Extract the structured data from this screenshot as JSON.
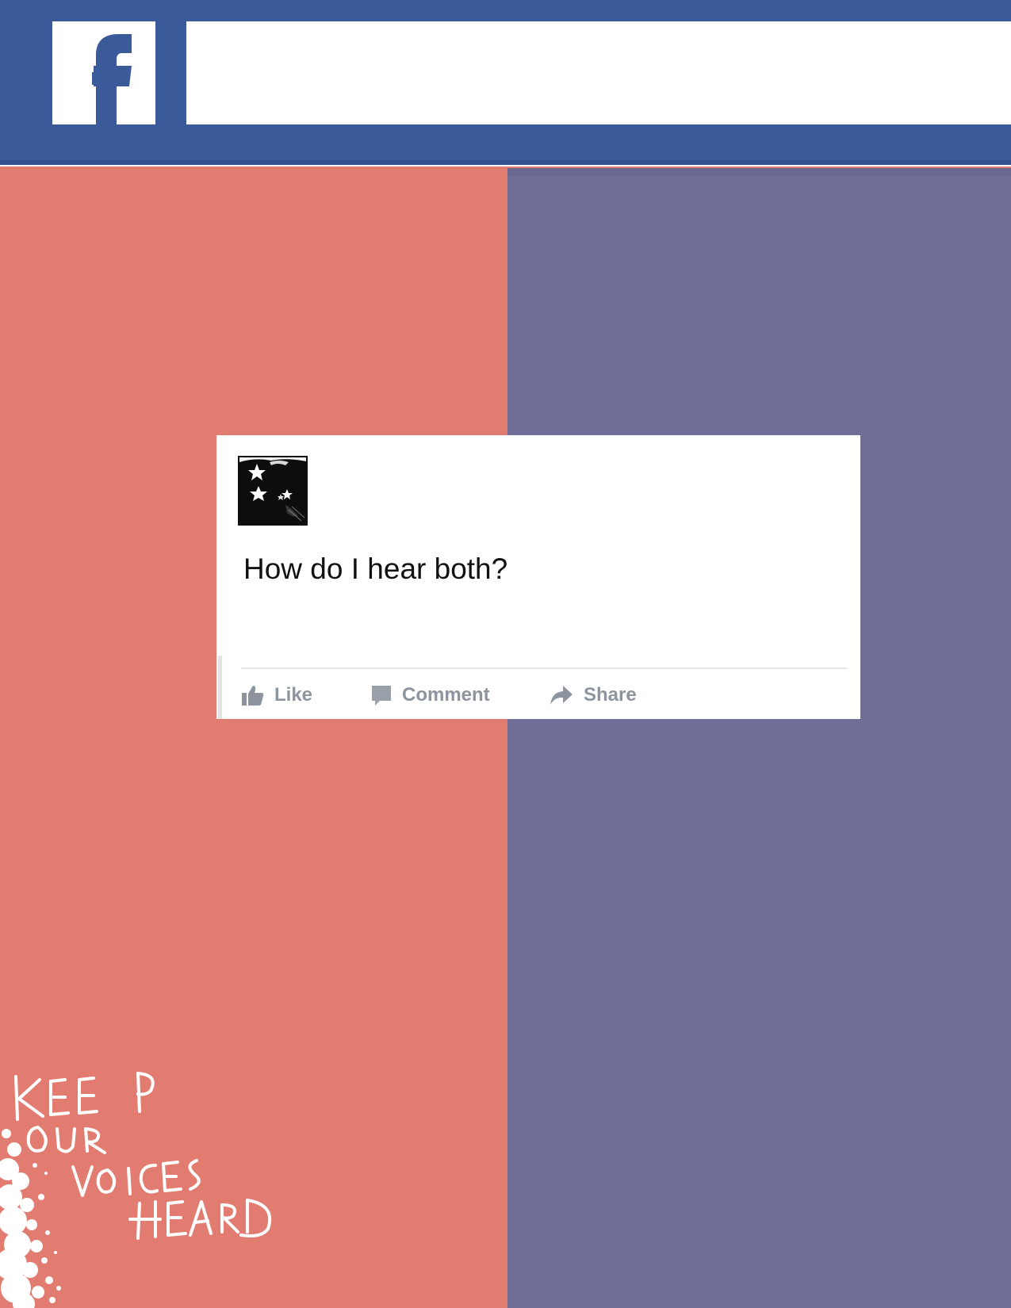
{
  "header": {
    "logo_icon": "facebook-f-icon",
    "search_value": "",
    "colors": {
      "bar": "#3b5a9a",
      "logo_f": "#3b5a9a"
    }
  },
  "background": {
    "left_color": "#e27c71",
    "right_color": "#706d96"
  },
  "post": {
    "avatar_icon": "stars-avatar-icon",
    "text": "How do I hear both?",
    "actions": [
      {
        "label": "Like",
        "icon": "thumbs-up-icon"
      },
      {
        "label": "Comment",
        "icon": "comment-bubble-icon"
      },
      {
        "label": "Share",
        "icon": "share-arrow-icon"
      }
    ],
    "action_color": "#8d949e"
  },
  "handwriting": {
    "text": "KEEP OUR VOICES HEARD",
    "color": "#ffffff"
  }
}
